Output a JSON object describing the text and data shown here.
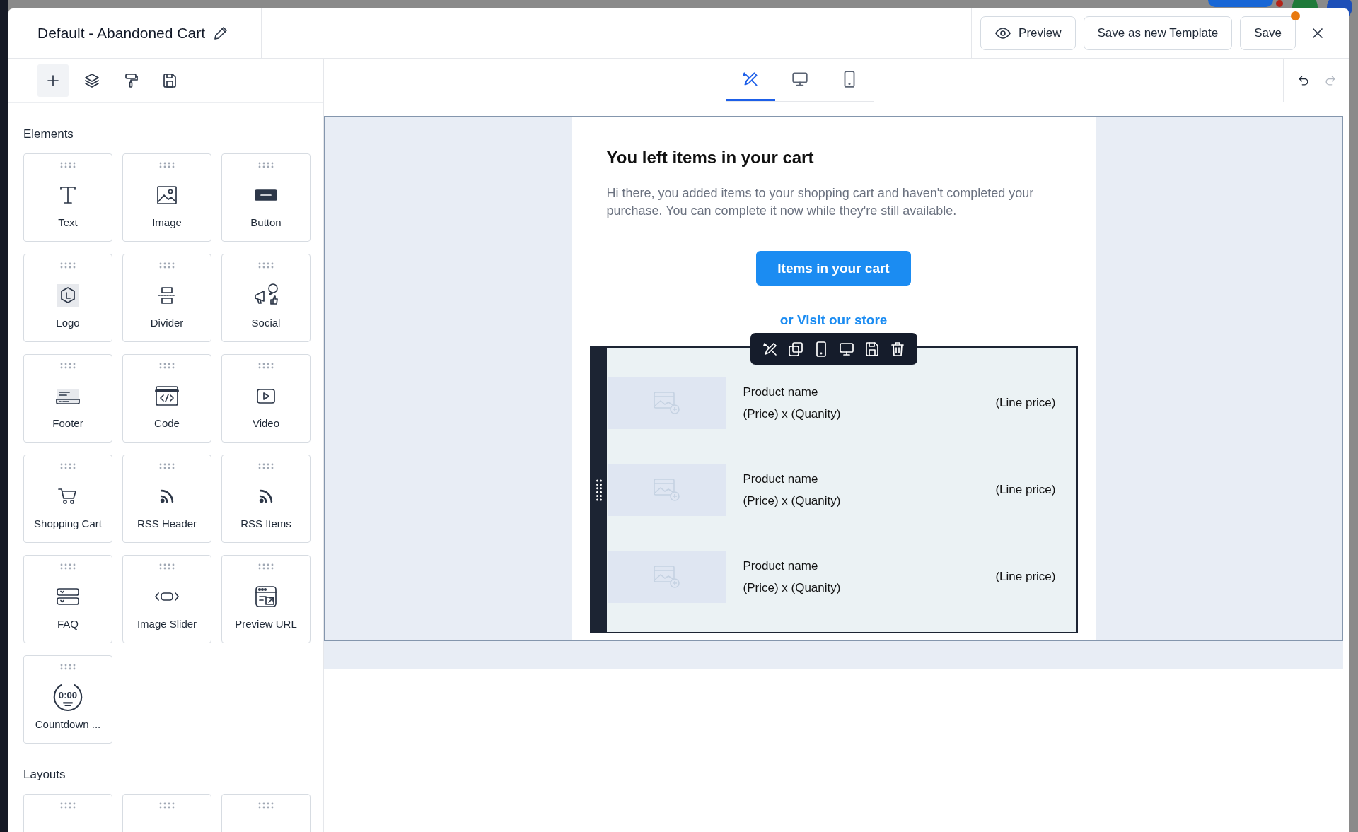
{
  "window": {
    "title": "Default - Abandoned Cart"
  },
  "header_buttons": [
    {
      "kind": "preview",
      "label": "Preview"
    },
    {
      "kind": "plain",
      "label": "Save as new Template"
    },
    {
      "kind": "save",
      "label": "Save",
      "unsaved": true
    }
  ],
  "sidebar": {
    "tools": [
      {
        "kind": "add",
        "selected": true
      },
      {
        "kind": "layers",
        "selected": false
      },
      {
        "kind": "style",
        "selected": false
      },
      {
        "kind": "saved",
        "selected": false
      }
    ],
    "sections": [
      {
        "title": "Elements",
        "items": [
          {
            "kind": "text",
            "label": "Text"
          },
          {
            "kind": "image",
            "label": "Image"
          },
          {
            "kind": "button",
            "label": "Button"
          },
          {
            "kind": "logo",
            "label": "Logo"
          },
          {
            "kind": "divider",
            "label": "Divider"
          },
          {
            "kind": "social",
            "label": "Social"
          },
          {
            "kind": "footer",
            "label": "Footer"
          },
          {
            "kind": "code",
            "label": "Code"
          },
          {
            "kind": "video",
            "label": "Video"
          },
          {
            "kind": "cart",
            "label": "Shopping Cart"
          },
          {
            "kind": "rss",
            "label": "RSS Header"
          },
          {
            "kind": "rss",
            "label": "RSS Items"
          },
          {
            "kind": "faq",
            "label": "FAQ"
          },
          {
            "kind": "slider",
            "label": "Image Slider"
          },
          {
            "kind": "preview_url",
            "label": "Preview URL"
          },
          {
            "kind": "countdown",
            "label": "Countdown ...",
            "icon_text": "0:00"
          }
        ]
      },
      {
        "title": "Layouts",
        "items": [
          {
            "kind": "layout"
          },
          {
            "kind": "layout"
          },
          {
            "kind": "layout"
          }
        ]
      }
    ]
  },
  "view_tabs": [
    {
      "kind": "edit",
      "selected": true
    },
    {
      "kind": "desktop",
      "selected": false
    },
    {
      "kind": "mobile",
      "selected": false
    }
  ],
  "history": [
    {
      "kind": "undo",
      "disabled": false
    },
    {
      "kind": "redo",
      "disabled": true
    }
  ],
  "email": {
    "heading": "You left items in your cart",
    "body": "Hi there, you added items to your shopping cart and haven't completed your purchase. You can complete it now while they're still available.",
    "button": "Items in your cart",
    "link": "or Visit our store",
    "cart_block": {
      "selected": true,
      "actions": [
        {
          "kind": "edit"
        },
        {
          "kind": "duplicate"
        },
        {
          "kind": "mobile"
        },
        {
          "kind": "desktop"
        },
        {
          "kind": "save"
        },
        {
          "kind": "delete"
        }
      ],
      "rows": [
        {
          "name": "Product name",
          "price": "(Price) x (Quanity)",
          "line_price": "(Line price)"
        },
        {
          "name": "Product name",
          "price": "(Price) x (Quanity)",
          "line_price": "(Line price)"
        },
        {
          "name": "Product name",
          "price": "(Price) x (Quanity)",
          "line_price": "(Line price)"
        }
      ]
    }
  }
}
